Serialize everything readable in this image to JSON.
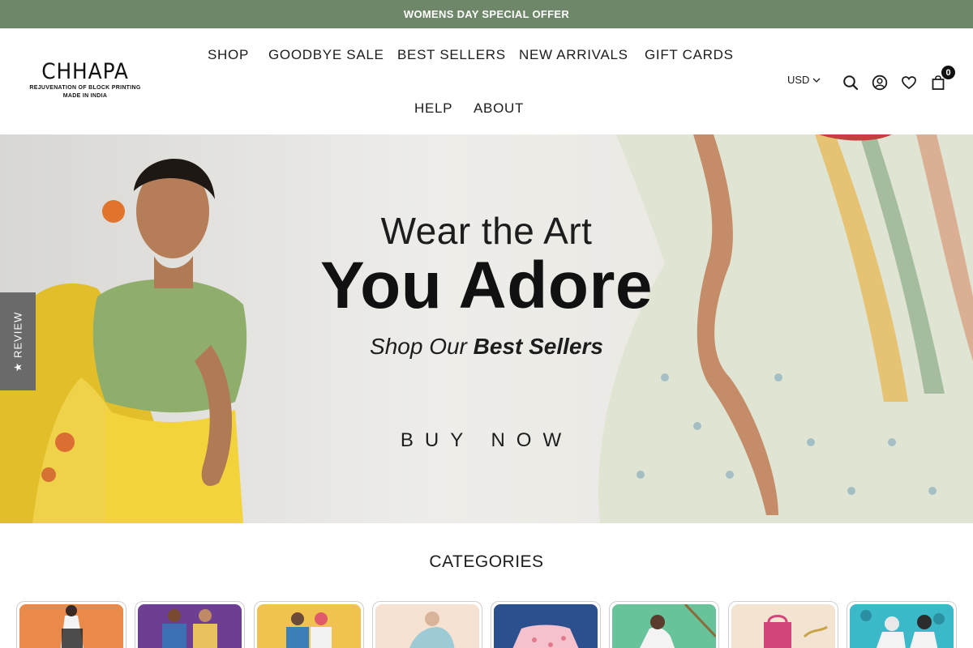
{
  "announcement": "WOMENS DAY SPECIAL OFFER",
  "brand": {
    "name": "CHHAPA",
    "tagline_1": "REJUVENATION OF BLOCK PRINTING",
    "tagline_2": "MADE IN INDIA"
  },
  "nav": {
    "items": [
      "SHOP",
      "GOODBYE SALE",
      "BEST SELLERS",
      "NEW ARRIVALS",
      "GIFT CARDS",
      "HELP",
      "ABOUT"
    ]
  },
  "header": {
    "currency": "USD",
    "cart_count": "0",
    "icons": [
      "search-icon",
      "account-icon",
      "wishlist-heart-icon",
      "cart-bag-icon"
    ]
  },
  "hero": {
    "line1": "Wear the Art",
    "line2": "You Adore",
    "line3_regular": "Shop Our ",
    "line3_bold": "Best Sellers",
    "cta": "BUY NOW"
  },
  "review_tab": "★ REVIEW",
  "categories": {
    "title": "CATEGORIES",
    "cards": [
      {
        "bg": "#e98a4a"
      },
      {
        "bg": "#6c3f93"
      },
      {
        "bg": "#f0c24e"
      },
      {
        "bg": "#f6e2d3"
      },
      {
        "bg": "#2c4f8e"
      },
      {
        "bg": "#68c29a"
      },
      {
        "bg": "#f3e4d2"
      },
      {
        "bg": "#3bb9c9"
      }
    ]
  },
  "colors": {
    "announcement_bg": "#6e8769",
    "text": "#1c1c1c",
    "review_tab_bg": "#6a6a6a"
  }
}
